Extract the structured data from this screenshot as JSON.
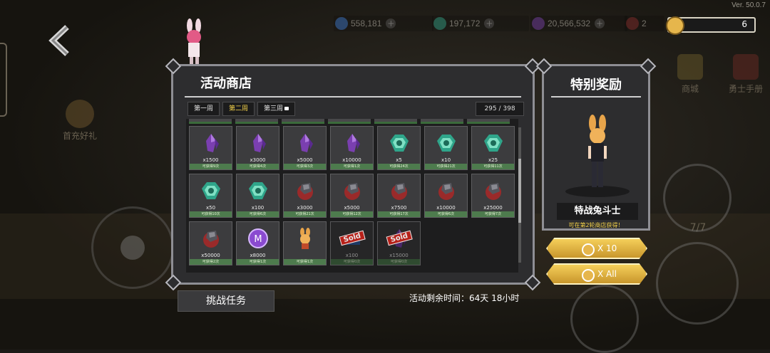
{
  "version": "Ver. 50.0.7",
  "currencies": [
    {
      "name": "blue-gem-currency",
      "value": "558,181",
      "color": "#3b7bd6"
    },
    {
      "name": "green-gem-currency",
      "value": "197,172",
      "color": "#2fa58a"
    },
    {
      "name": "purple-crystal-currency",
      "value": "20,566,532",
      "color": "#7a3fb0"
    },
    {
      "name": "dark-ore-currency",
      "value": "2",
      "color": "#8a2a2a"
    }
  ],
  "coin_counter": {
    "value": "6",
    "fill_fraction": 0.14
  },
  "left_side": {
    "gift_label": "首充好礼"
  },
  "right_side": {
    "shop_label": "商城",
    "handbook_label": "勇士手册",
    "counter": "7/7"
  },
  "shop": {
    "title": "活动商店",
    "tabs": [
      {
        "label": "第一周",
        "active": false,
        "locked": false
      },
      {
        "label": "第二周",
        "active": true,
        "locked": false
      },
      {
        "label": "第三周",
        "active": false,
        "locked": true
      }
    ],
    "progress": "295 / 398",
    "items": [
      {
        "icon": "purple-crystal-icon",
        "qty": "x1500",
        "limit": "可获得9次",
        "sold": false
      },
      {
        "icon": "purple-crystal-icon",
        "qty": "x3000",
        "limit": "可获得4次",
        "sold": false
      },
      {
        "icon": "purple-crystal-icon",
        "qty": "x5000",
        "limit": "可获得3次",
        "sold": false
      },
      {
        "icon": "purple-crystal-icon",
        "qty": "x10000",
        "limit": "可获得1次",
        "sold": false
      },
      {
        "icon": "green-gem-icon",
        "qty": "x5",
        "limit": "可获得24次",
        "sold": false
      },
      {
        "icon": "green-gem-icon",
        "qty": "x10",
        "limit": "可获得21次",
        "sold": false
      },
      {
        "icon": "green-gem-icon",
        "qty": "x25",
        "limit": "可获得11次",
        "sold": false
      },
      {
        "icon": "green-gem-icon",
        "qty": "x50",
        "limit": "可获得10次",
        "sold": false
      },
      {
        "icon": "green-gem-icon",
        "qty": "x100",
        "limit": "可获得6次",
        "sold": false
      },
      {
        "icon": "dark-ore-icon",
        "qty": "x3000",
        "limit": "可获得21次",
        "sold": false
      },
      {
        "icon": "dark-ore-icon",
        "qty": "x5000",
        "limit": "可获得12次",
        "sold": false
      },
      {
        "icon": "dark-ore-icon",
        "qty": "x7500",
        "limit": "可获得17次",
        "sold": false
      },
      {
        "icon": "dark-ore-icon",
        "qty": "x10000",
        "limit": "可获得6次",
        "sold": false
      },
      {
        "icon": "dark-ore-icon",
        "qty": "x25000",
        "limit": "可获得7次",
        "sold": false
      },
      {
        "icon": "dark-ore-icon",
        "qty": "x50000",
        "limit": "可获得2次",
        "sold": false
      },
      {
        "icon": "m-coin-icon",
        "qty": "x8000",
        "limit": "可获得1次",
        "sold": false
      },
      {
        "icon": "bunny-girl-icon",
        "qty": "",
        "limit": "可获得1次",
        "sold": false
      },
      {
        "icon": "blue-box-icon",
        "qty": "x100",
        "limit": "可获得0次",
        "sold": true,
        "sold_label": "Sold"
      },
      {
        "icon": "purple-crystal-icon",
        "qty": "x15000",
        "limit": "可获得0次",
        "sold": true,
        "sold_label": "Sold"
      }
    ]
  },
  "challenge_button": "挑战任务",
  "timer_text": "活动剩余时间：64天 18小时",
  "reward": {
    "title": "特别奖励",
    "name": "特战兔斗士",
    "note": "可在第2轮商店获得！"
  },
  "buttons": {
    "x10": "X 10",
    "xall": "X All"
  },
  "colors": {
    "gold": "#e6b64c",
    "limit_green": "#4d7b4d",
    "sold_red": "#c8221a",
    "tab_active": "#f5d34a"
  }
}
